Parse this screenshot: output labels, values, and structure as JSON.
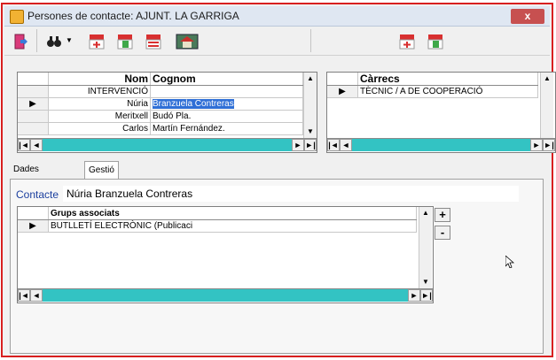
{
  "window": {
    "title": "Persones de contacte: AJUNT. LA GARRIGA",
    "close_label": "x"
  },
  "toolbar": {
    "icons": [
      "exit-door-icon",
      "binoculars-search-icon",
      "new-record-icon",
      "delete-record-icon",
      "edit-record-icon",
      "building-icon",
      "new-record-icon",
      "delete-record-icon"
    ]
  },
  "contacts_grid": {
    "headers": {
      "nom": "Nom",
      "cognom": "Cognom"
    },
    "rows": [
      {
        "nom": "INTERVENCIÓ",
        "cognom": ""
      },
      {
        "nom": "Núria",
        "cognom": "Branzuela Contreras"
      },
      {
        "nom": "Meritxell",
        "cognom": "Budó Pla."
      },
      {
        "nom": "Carlos",
        "cognom": "Martín Fernández."
      }
    ],
    "current_row": 1
  },
  "carrecs_grid": {
    "header": "Càrrecs",
    "rows": [
      "TÈCNIC / A DE COOPERACIÓ"
    ]
  },
  "tabs": [
    "Dades personals",
    "Gestió de Grups"
  ],
  "active_tab": "Gestió de Grups",
  "contact": {
    "label": "Contacte",
    "value": "Núria Branzuela Contreras"
  },
  "groups_grid": {
    "header": "Grups associats",
    "rows": [
      "BUTLLETÍ ELECTRÒNIC (Publicaci"
    ],
    "add_label": "+",
    "remove_label": "-"
  },
  "navigator": {
    "first": "|◄",
    "prev": "◄",
    "next": "►",
    "last": "►|"
  }
}
